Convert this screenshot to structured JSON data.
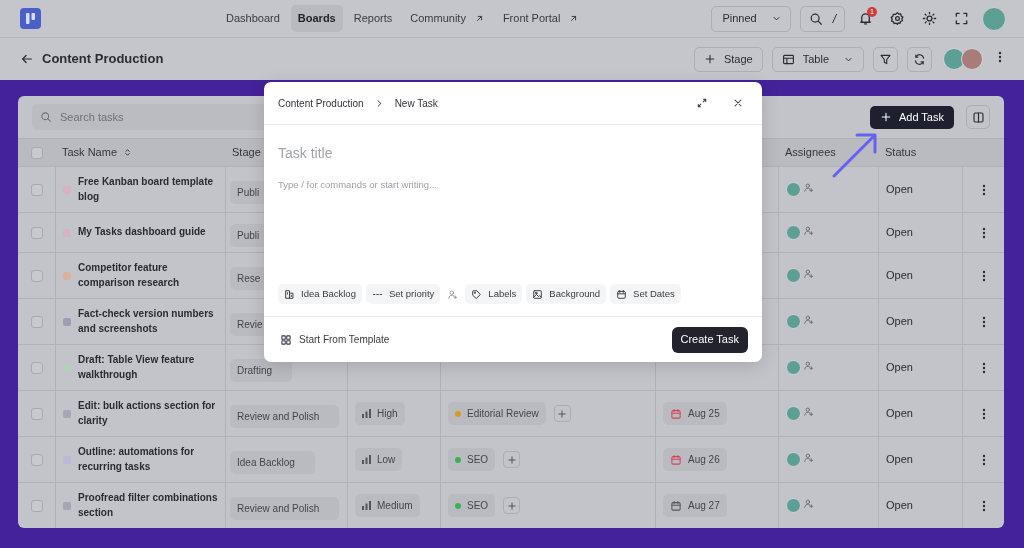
{
  "navbar": {
    "links": [
      {
        "label": "Dashboard",
        "selected": false,
        "external": false
      },
      {
        "label": "Boards",
        "selected": true,
        "external": false
      },
      {
        "label": "Reports",
        "selected": false,
        "external": false
      },
      {
        "label": "Community",
        "selected": false,
        "external": true
      },
      {
        "label": "Front Portal",
        "selected": false,
        "external": true
      }
    ],
    "pinned": "Pinned",
    "search_shortcut": "/",
    "notification_count": "1"
  },
  "header": {
    "title": "Content Production",
    "stage_button": "Stage",
    "view_select": "Table"
  },
  "toolbar": {
    "search": {
      "placeholder": "Search tasks"
    },
    "add_button": "Add Task"
  },
  "table": {
    "all_checked": false,
    "columns": [
      {
        "label": "Task Name",
        "sortable": true
      },
      {
        "label": "Stage",
        "sortable": false
      },
      {
        "label": "Assignees",
        "sortable": false
      },
      {
        "label": "Status",
        "sortable": false
      }
    ],
    "rows": [
      {
        "checked": false,
        "name": "Free Kanban board template blog",
        "color": "#d8b2c0",
        "stage": "Publi",
        "status": "Open"
      },
      {
        "checked": false,
        "name": "My Tasks dashboard guide",
        "color": "#d6b3c6",
        "stage": "Publi",
        "status": "Open"
      },
      {
        "checked": false,
        "name": "Competitor feature comparison research",
        "color": "#d8b39c",
        "stage": "Rese",
        "status": "Open"
      },
      {
        "checked": false,
        "name": "Fact-check version numbers and screenshots",
        "color": "#9e9db6",
        "stage": "Revie",
        "status": "Open"
      },
      {
        "checked": false,
        "name": "Draft: Table View feature walkthrough",
        "color": "#b6cfba",
        "stage": "Drafting",
        "status": "Open"
      },
      {
        "checked": false,
        "name": "Edit: bulk actions section for clarity",
        "color": "#a5a6b8",
        "stage": "Review and Polish",
        "priority": "High",
        "labels": [
          {
            "text": "Editorial Review",
            "color": "#d89a2a"
          }
        ],
        "due": {
          "text": "Aug 25",
          "overdue": true
        },
        "status": "Open"
      },
      {
        "checked": false,
        "name": "Outline: automations for recurring tasks",
        "color": "#bcb8d6",
        "stage": "Idea Backlog",
        "priority": "Low",
        "labels": [
          {
            "text": "SEO",
            "color": "#3fae5a"
          }
        ],
        "due": {
          "text": "Aug 26",
          "overdue": true
        },
        "status": "Open"
      },
      {
        "checked": false,
        "name": "Proofread filter combinations section",
        "color": "#a4a5b6",
        "stage": "Review and Polish",
        "priority": "Medium",
        "labels": [
          {
            "text": "SEO",
            "color": "#3fae5a"
          }
        ],
        "due": {
          "text": "Aug 27",
          "overdue": false
        },
        "status": "Open"
      }
    ]
  },
  "modal": {
    "breadcrumb": [
      "Content Production",
      "New Task"
    ],
    "title": {
      "placeholder": "Task title"
    },
    "body": {
      "placeholder": "Type / for commands or start writing..."
    },
    "chips": [
      {
        "kind": "stage",
        "label": "Idea Backlog"
      },
      {
        "kind": "priority",
        "label": "Set priority"
      },
      {
        "kind": "assignee"
      },
      {
        "kind": "labels",
        "label": "Labels"
      },
      {
        "kind": "background",
        "label": "Background"
      },
      {
        "kind": "dates",
        "label": "Set Dates"
      }
    ],
    "template_link": "Start From Template",
    "submit": "Create Task"
  }
}
